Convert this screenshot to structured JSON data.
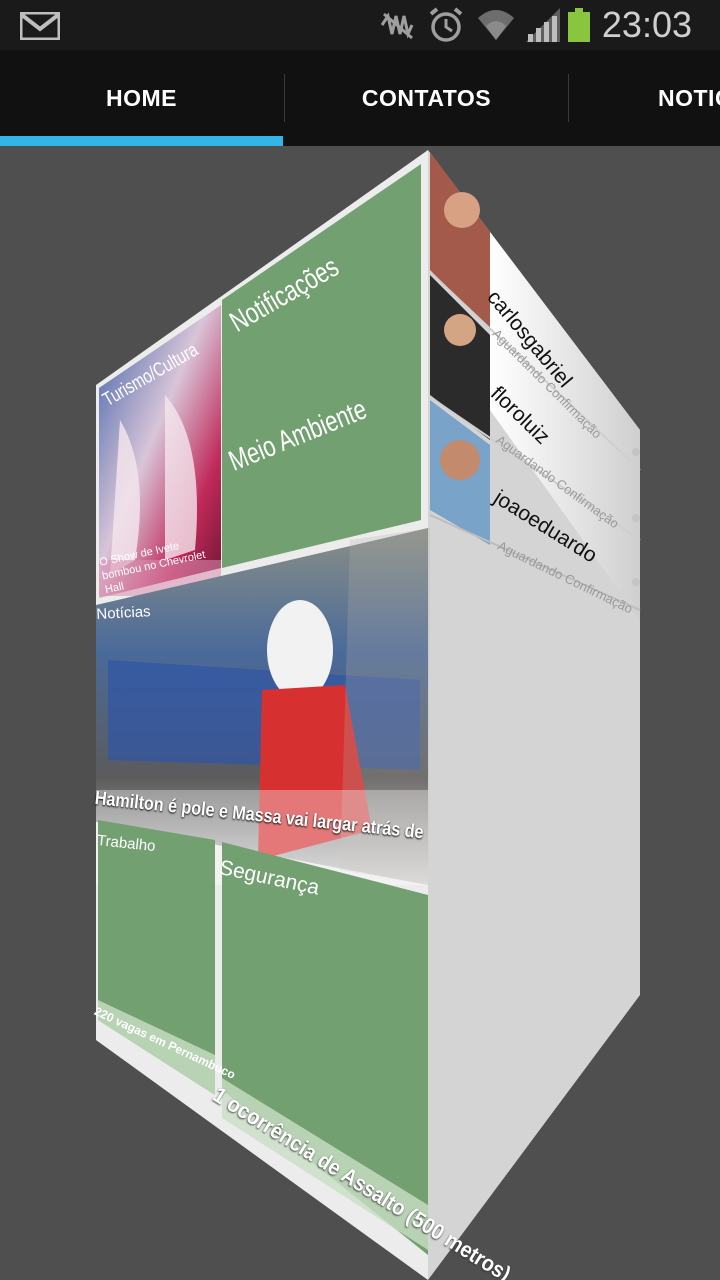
{
  "statusbar": {
    "time": "23:03",
    "icons": [
      "gmail-icon",
      "mute-icon",
      "alarm-icon",
      "wifi-icon",
      "signal-icon",
      "battery-icon"
    ],
    "battery_color": "#8ac53f"
  },
  "tabs": [
    {
      "label": "HOME",
      "active": true
    },
    {
      "label": "CONTATOS",
      "active": false
    },
    {
      "label": "NOTIC",
      "active": false
    }
  ],
  "accent_color": "#33b5e5",
  "tile_green": "#72a070",
  "cube": {
    "tiles": {
      "notificacoes": {
        "label": "Notificações"
      },
      "meio_ambiente": {
        "label": "Meio Ambiente"
      },
      "turismo": {
        "label": "Turismo/Cultura",
        "caption": "O Show de Ivete bombou no Chevrolet Hall"
      },
      "noticias": {
        "label": "Notícias",
        "caption": "Hamilton é pole e Massa vai largar atrás de"
      },
      "trabalho": {
        "label": "Trabalho",
        "caption": "220 vagas em Pernambuco"
      },
      "seguranca": {
        "label": "Segurança",
        "caption": "1 ocorrência de Assalto (500 metros)"
      }
    },
    "contacts": [
      {
        "name": "carlosgabriel",
        "status": "Aguardando Confirmação"
      },
      {
        "name": "floroluiz",
        "status": "Aguardando Confirmação"
      },
      {
        "name": "joaoeduardo",
        "status": "Aguardando Confirmação"
      }
    ]
  }
}
